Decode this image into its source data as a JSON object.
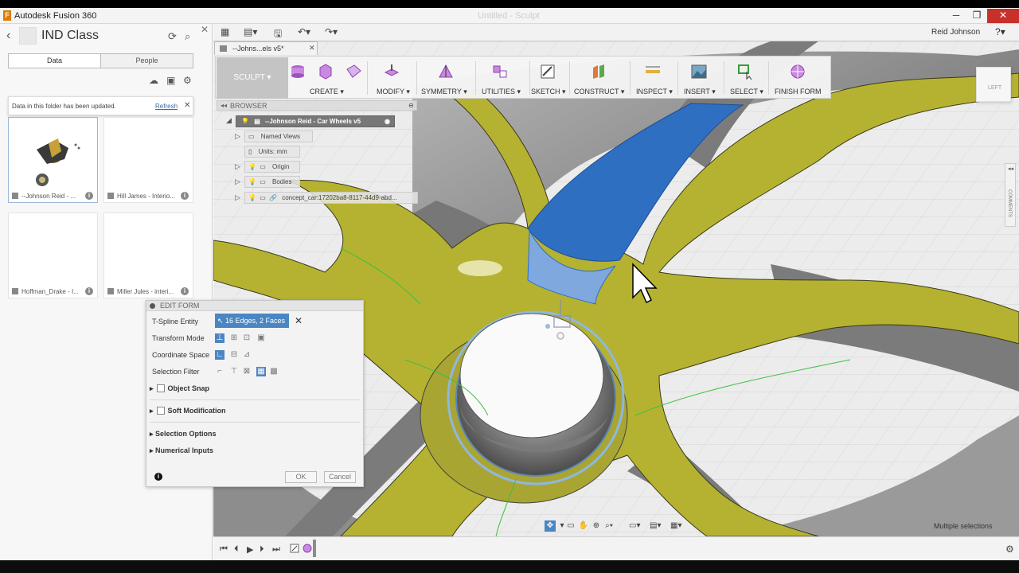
{
  "window": {
    "app_title": "Autodesk Fusion 360",
    "doc_title": "Untitled - Sculpt",
    "minimize": "─",
    "maximize": "❐",
    "close": "✕"
  },
  "data_panel": {
    "project_title": "IND Class",
    "tabs": [
      "Data",
      "People"
    ],
    "active_tab": "Data",
    "notice": "Data in this folder has been updated.",
    "notice_action": "Refresh",
    "files": [
      {
        "name": "--Johnson Reid - ...",
        "selected": true
      },
      {
        "name": "Hill James - Interio...",
        "selected": false
      },
      {
        "name": "Hoffman_Drake - I...",
        "selected": false
      },
      {
        "name": "Miller Jules - interi...",
        "selected": false
      }
    ]
  },
  "app_bar": {
    "user": "Reid Johnson",
    "help": "?"
  },
  "doc_tab": {
    "label": "--Johns...els v5*",
    "close": "✕"
  },
  "toolbar": {
    "workspace": "SCULPT",
    "groups": [
      "CREATE",
      "MODIFY",
      "SYMMETRY",
      "UTILITIES",
      "SKETCH",
      "CONSTRUCT",
      "INSPECT",
      "INSERT",
      "SELECT",
      "FINISH FORM"
    ]
  },
  "browser": {
    "title": "BROWSER",
    "root": "--Johnson Reid - Car Wheels v5",
    "items": [
      "Named Views",
      "Units: mm",
      "Origin",
      "Bodies",
      "concept_car:17202ba8-8117-44d9-abd..."
    ]
  },
  "edit_form": {
    "title": "EDIT FORM",
    "labels": {
      "tspline_entity": "T-Spline Entity",
      "transform_mode": "Transform Mode",
      "coordinate_space": "Coordinate Space",
      "selection_filter": "Selection Filter"
    },
    "selection_value": "16 Edges, 2 Faces",
    "sections": {
      "object_snap": "Object Snap",
      "soft_modification": "Soft Modification",
      "selection_options": "Selection Options",
      "numerical_inputs": "Numerical Inputs"
    },
    "ok": "OK",
    "cancel": "Cancel"
  },
  "comments_panel": "COMMENTS",
  "view_cube_face": "LEFT",
  "status": "Multiple selections",
  "colors": {
    "accent": "#4b86c4",
    "surface": "#b5b232",
    "selected_face": "#2f6fc2"
  }
}
